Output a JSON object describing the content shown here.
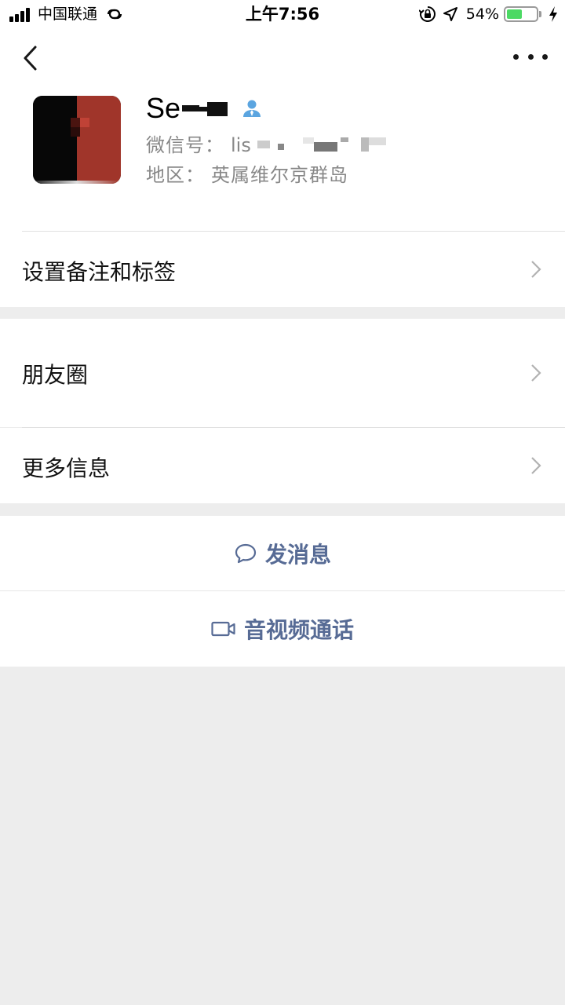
{
  "status_bar": {
    "carrier": "中国联通",
    "time": "上午7:56",
    "battery_percent": "54%",
    "battery_level": 0.54,
    "icons": [
      "signal-icon",
      "link-icon",
      "rotation-lock-icon",
      "location-icon",
      "battery-icon",
      "charging-icon"
    ]
  },
  "nav": {
    "back_icon": "chevron-left-icon",
    "more_icon": "more-dots-icon"
  },
  "profile": {
    "name": "Se",
    "wechat_id_label": "微信号：",
    "wechat_id_value": "lis",
    "region_label": "地区：",
    "region_value": "英属维尔京群岛",
    "verified_icon": "person-icon"
  },
  "menu": {
    "remark_tags": "设置备注和标签",
    "moments": "朋友圈",
    "more_info": "更多信息"
  },
  "actions": {
    "send_message": "发消息",
    "video_call": "音视频通话"
  },
  "colors": {
    "link_blue": "#576b95",
    "background": "#ededed",
    "battery_green": "#4cd964"
  }
}
